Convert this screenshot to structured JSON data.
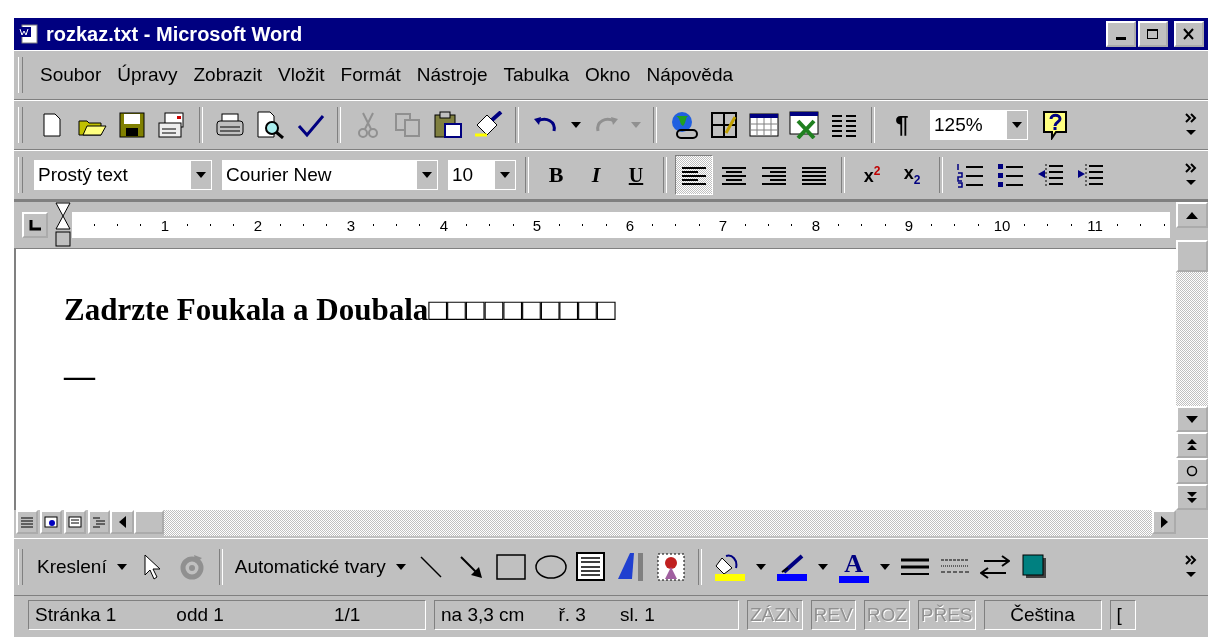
{
  "window": {
    "title": "rozkaz.txt - Microsoft Word"
  },
  "menu": [
    {
      "label": "Soubor"
    },
    {
      "label": "Úpravy"
    },
    {
      "label": "Zobrazit"
    },
    {
      "label": "Vložit"
    },
    {
      "label": "Formát"
    },
    {
      "label": "Nástroje"
    },
    {
      "label": "Tabulka"
    },
    {
      "label": "Okno"
    },
    {
      "label": "Nápověda"
    }
  ],
  "standard_toolbar": {
    "cut": {
      "disabled": true
    },
    "copy": {
      "disabled": true
    },
    "redo": {
      "disabled": true
    },
    "pilcrow": "¶",
    "zoom": "125%"
  },
  "formatting_toolbar": {
    "style": "Prostý text",
    "font": "Courier New",
    "size": "10",
    "bold": "B",
    "italic": "I",
    "underline": "U",
    "alignment": [
      {
        "selected": true
      },
      {
        "selected": false
      },
      {
        "selected": false
      },
      {
        "selected": false
      }
    ],
    "superscript": "x$^{2}$",
    "subscript": "x$_{2}$"
  },
  "ruler": {
    "numbers": [
      "1",
      "2",
      "3",
      "4",
      "5",
      "6",
      "7",
      "8",
      "9",
      "10",
      "11"
    ]
  },
  "document": {
    "lines": [
      "Zadrzte Foukala a Doubala□□□□□□□□□□",
      "—"
    ]
  },
  "drawing_toolbar": {
    "drawing": "Kreslení",
    "autoshapes": "Automatické tvary",
    "colors": [
      {
        "kind": "fill",
        "color": "#ffff00"
      },
      {
        "kind": "line",
        "color": "#0000ff"
      },
      {
        "kind": "font",
        "label": "A",
        "color": "#0000ff"
      }
    ]
  },
  "status_bar": [
    {
      "items": [
        {
          "text": "Stránka  1",
          "disabled": false
        },
        {
          "text": "odd  1",
          "disabled": false
        },
        {
          "text": "1/1",
          "disabled": false
        }
      ]
    },
    {
      "items": [
        {
          "text": "na  3,3 cm",
          "disabled": false
        },
        {
          "text": "ř.  3",
          "disabled": false
        },
        {
          "text": "sl.  1",
          "disabled": false
        }
      ]
    },
    {
      "items": [
        {
          "text": "ZÁZN",
          "disabled": true
        }
      ]
    },
    {
      "items": [
        {
          "text": "REV",
          "disabled": true
        }
      ]
    },
    {
      "items": [
        {
          "text": "ROZ",
          "disabled": true
        }
      ]
    },
    {
      "items": [
        {
          "text": "PŘES",
          "disabled": true
        }
      ]
    },
    {
      "items": [
        {
          "text": "Čeština",
          "disabled": false
        }
      ]
    },
    {
      "items": [
        {
          "text": "[",
          "disabled": false
        }
      ]
    }
  ]
}
